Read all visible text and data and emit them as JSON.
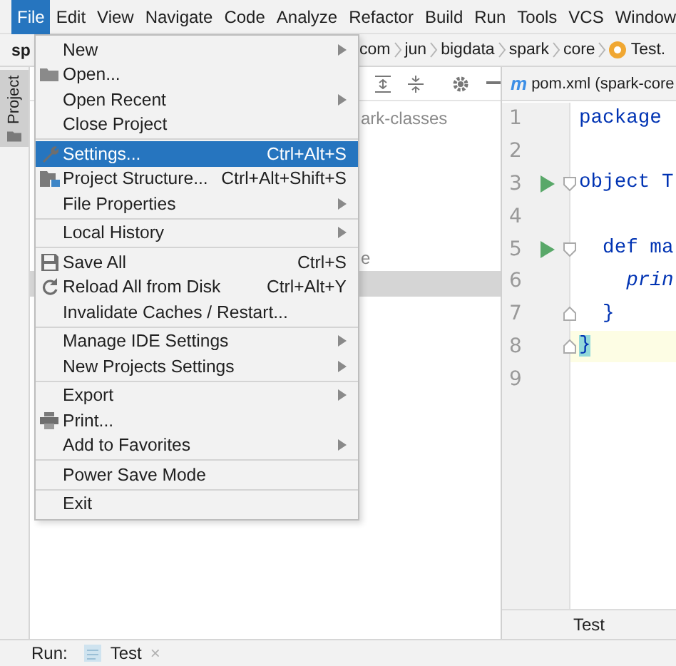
{
  "menu_bar": [
    {
      "label": "File",
      "selected": true
    },
    {
      "label": "Edit",
      "selected": false
    },
    {
      "label": "View",
      "selected": false
    },
    {
      "label": "Navigate",
      "selected": false
    },
    {
      "label": "Code",
      "selected": false
    },
    {
      "label": "Analyze",
      "selected": false
    },
    {
      "label": "Refactor",
      "selected": false
    },
    {
      "label": "Build",
      "selected": false
    },
    {
      "label": "Run",
      "selected": false
    },
    {
      "label": "Tools",
      "selected": false
    },
    {
      "label": "VCS",
      "selected": false
    },
    {
      "label": "Window",
      "selected": false
    }
  ],
  "breadcrumbs": {
    "project": "sp",
    "path": [
      "com",
      "jun",
      "bigdata",
      "spark",
      "core"
    ],
    "file": "Test."
  },
  "side_tab": {
    "label": "Project",
    "selected": true
  },
  "project_tree": [
    {
      "label": "ark-classes",
      "selected": false
    },
    {
      "label": "e",
      "selected": false
    },
    {
      "selected": true
    }
  ],
  "editor": {
    "tab_icon": "m",
    "tab": "pom.xml (spark-core",
    "lines": [
      {
        "number": "1",
        "code": "package",
        "runnable": false,
        "fold_open": false,
        "fold_close": false,
        "current": false,
        "italic": false
      },
      {
        "number": "2",
        "runnable": false,
        "fold_open": false,
        "fold_close": false,
        "current": false
      },
      {
        "number": "3",
        "code": "object T",
        "runnable": true,
        "fold_open": true,
        "fold_close": false,
        "current": false,
        "italic": false
      },
      {
        "number": "4",
        "runnable": false,
        "fold_open": false,
        "fold_close": false,
        "current": false
      },
      {
        "number": "5",
        "code": "  def ma",
        "runnable": true,
        "fold_open": true,
        "fold_close": false,
        "current": false,
        "italic": false
      },
      {
        "number": "6",
        "code": "    prin",
        "runnable": false,
        "fold_open": false,
        "fold_close": false,
        "current": false,
        "italic": true
      },
      {
        "number": "7",
        "code": "  }",
        "runnable": false,
        "fold_open": false,
        "fold_close": true,
        "current": false,
        "italic": false
      },
      {
        "number": "8",
        "code": "}",
        "runnable": false,
        "fold_open": false,
        "fold_close": true,
        "current": true,
        "italic": false
      },
      {
        "number": "9",
        "runnable": false,
        "fold_open": false,
        "fold_close": false,
        "current": false
      }
    ],
    "footer": "Test"
  },
  "file_menu": [
    [
      {
        "label": "New",
        "submenu": true,
        "selected": false
      },
      {
        "label": "Open...",
        "submenu": false,
        "selected": false
      },
      {
        "label": "Open Recent",
        "submenu": true,
        "selected": false
      },
      {
        "label": "Close Project",
        "submenu": false,
        "selected": false
      }
    ],
    [
      {
        "label": "Settings...",
        "shortcut": "Ctrl+Alt+S",
        "submenu": false,
        "selected": true
      },
      {
        "label": "Project Structure...",
        "shortcut": "Ctrl+Alt+Shift+S",
        "submenu": false,
        "selected": false
      },
      {
        "label": "File Properties",
        "submenu": true,
        "selected": false
      }
    ],
    [
      {
        "label": "Local History",
        "submenu": true,
        "selected": false
      }
    ],
    [
      {
        "label": "Save All",
        "shortcut": "Ctrl+S",
        "submenu": false,
        "selected": false
      },
      {
        "label": "Reload All from Disk",
        "shortcut": "Ctrl+Alt+Y",
        "submenu": false,
        "selected": false
      },
      {
        "label": "Invalidate Caches / Restart...",
        "submenu": false,
        "selected": false
      }
    ],
    [
      {
        "label": "Manage IDE Settings",
        "submenu": true,
        "selected": false
      },
      {
        "label": "New Projects Settings",
        "submenu": true,
        "selected": false
      }
    ],
    [
      {
        "label": "Export",
        "submenu": true,
        "selected": false
      },
      {
        "label": "Print...",
        "submenu": false,
        "selected": false
      },
      {
        "label": "Add to Favorites",
        "submenu": true,
        "selected": false
      }
    ],
    [
      {
        "label": "Power Save Mode",
        "submenu": false,
        "selected": false
      }
    ],
    [
      {
        "label": "Exit",
        "submenu": false,
        "selected": false
      }
    ]
  ],
  "run_bar": {
    "label": "Run:",
    "tab": "Test",
    "close": "×"
  }
}
